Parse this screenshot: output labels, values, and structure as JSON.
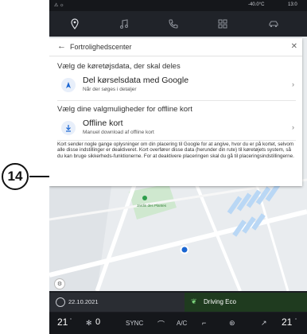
{
  "callout": {
    "number": "14"
  },
  "status": {
    "left_icons": "⚠ ☼",
    "temperature": "-40.0°C",
    "time": "13:0"
  },
  "nav": [
    "location-pin-icon",
    "music-note-icon",
    "phone-icon",
    "apps-grid-icon",
    "car-icon"
  ],
  "panel": {
    "title": "Fortrolighedscenter",
    "section1": "Vælg de køretøjsdata, der skal deles",
    "row1": {
      "title": "Del kørselsdata med Google",
      "subtitle": "Når der søges i detaljer"
    },
    "section2": "Vælg dine valgmuligheder for offline kort",
    "row2": {
      "title": "Offline kort",
      "subtitle": "Manuel download af offline kort"
    },
    "info": "Kort sender nogle gange oplysninger om din placering til Google for at angive, hvor du er på kortet, selvom alle disse indstillinger er deaktiveret. Kort overfører disse data (herunder din rute) til køretøjets system, så du kan bruge sikkerheds-funktionerne. For at deaktivere placeringen skal du gå til placeringsindstillingerne."
  },
  "map": {
    "poi_label": "Jardin des Plantes"
  },
  "bottom": {
    "date": "22.10.2021",
    "eco": "Driving Eco"
  },
  "climate": {
    "left_temp": "21",
    "fan": "0",
    "sync": "SYNC",
    "ac": "A/C",
    "right_temp": "21"
  }
}
